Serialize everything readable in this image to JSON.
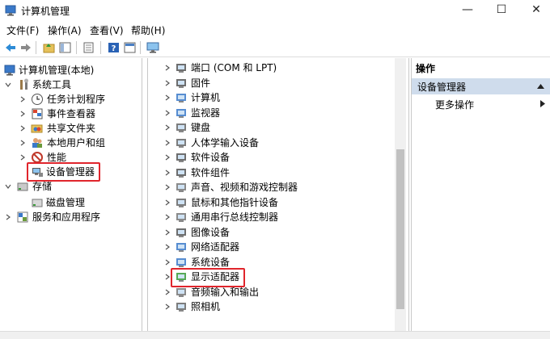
{
  "window": {
    "title": "计算机管理",
    "min": "—",
    "max": "☐",
    "close": "✕"
  },
  "menu": [
    "文件(F)",
    "操作(A)",
    "查看(V)",
    "帮助(H)"
  ],
  "left_tree": [
    {
      "label": "计算机管理(本地)"
    },
    {
      "label": "系统工具"
    },
    {
      "label": "任务计划程序"
    },
    {
      "label": "事件查看器"
    },
    {
      "label": "共享文件夹"
    },
    {
      "label": "本地用户和组"
    },
    {
      "label": "性能"
    },
    {
      "label": "设备管理器"
    },
    {
      "label": "存储"
    },
    {
      "label": "磁盘管理"
    },
    {
      "label": "服务和应用程序"
    }
  ],
  "devices": [
    "端口 (COM 和 LPT)",
    "固件",
    "计算机",
    "监视器",
    "键盘",
    "人体学输入设备",
    "软件设备",
    "软件组件",
    "声音、视频和游戏控制器",
    "鼠标和其他指针设备",
    "通用串行总线控制器",
    "图像设备",
    "网络适配器",
    "系统设备",
    "显示适配器",
    "音频输入和输出",
    "照相机"
  ],
  "actions": {
    "title": "操作",
    "section": "设备管理器",
    "more": "更多操作"
  },
  "colors": {
    "highlight_box": "#e0252c",
    "actions_bar": "#cfdcec"
  }
}
